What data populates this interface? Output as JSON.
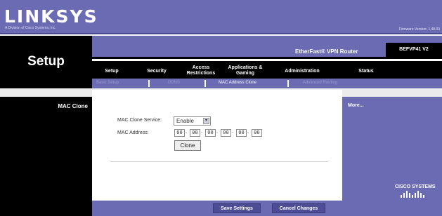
{
  "brand": {
    "logo": "LINKSYS",
    "tagline": "A Division of Cisco Systems, Inc.",
    "firmware": "Firmware Version: 1.48.03"
  },
  "page": {
    "title": "Setup"
  },
  "product": {
    "name": "EtherFast® VPN Router",
    "model": "BEFVP41 V2"
  },
  "tabs": [
    {
      "label": "Setup"
    },
    {
      "label": "Security"
    },
    {
      "label": "Access Restrictions"
    },
    {
      "label": "Applications & Gaming"
    },
    {
      "label": "Administration"
    },
    {
      "label": "Status"
    }
  ],
  "subtabs": [
    {
      "label": "Basic Setup"
    },
    {
      "label": "DDNS"
    },
    {
      "label": "MAC Address Clone"
    },
    {
      "label": "Advanced Routing"
    }
  ],
  "section": {
    "label": "MAC Clone"
  },
  "form": {
    "service_label": "MAC Clone Service:",
    "service_value": "Enable",
    "address_label": "MAC Address:",
    "mac_octets": [
      "00",
      "00",
      "00",
      "00",
      "00",
      "00"
    ],
    "clone_button": "Clone"
  },
  "help": {
    "more_link": "More..."
  },
  "footer": {
    "save_button": "Save Settings",
    "cancel_button": "Cancel Changes"
  },
  "vendor": {
    "cisco": "CISCO SYSTEMS"
  },
  "colors": {
    "accent": "#6b6bb4",
    "dark": "#000000"
  },
  "icons": {
    "select_arrow": "chevron-down-icon",
    "cisco_mark": "cisco-bridge-logo-icon"
  }
}
